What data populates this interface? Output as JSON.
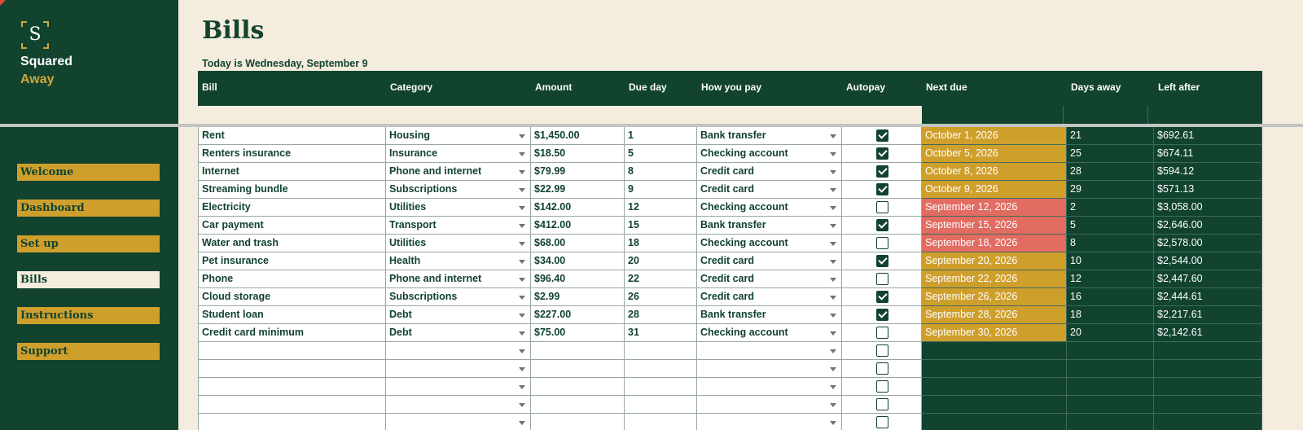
{
  "brand": {
    "logo_letter": "S",
    "name_line1": "Squared",
    "name_line2": "Away"
  },
  "nav": [
    {
      "label": "Welcome",
      "active": false
    },
    {
      "label": "Dashboard",
      "active": false
    },
    {
      "label": "Set up",
      "active": false
    },
    {
      "label": "Bills",
      "active": true
    },
    {
      "label": "Instructions",
      "active": false
    },
    {
      "label": "Support",
      "active": false
    }
  ],
  "page": {
    "title": "Bills",
    "today": "Today is Wednesday, September 9"
  },
  "columns": [
    "Bill",
    "Category",
    "Amount",
    "Due day",
    "How you pay",
    "Autopay",
    "Next due",
    "Days away",
    "Left after"
  ],
  "rows": [
    {
      "bill": "Rent",
      "category": "Housing",
      "amount": "$1,450.00",
      "due_day": "1",
      "pay": "Bank transfer",
      "autopay": true,
      "next_due": "October 1, 2026",
      "status": "gold",
      "days_away": "21",
      "left_after": "$692.61"
    },
    {
      "bill": "Renters insurance",
      "category": "Insurance",
      "amount": "$18.50",
      "due_day": "5",
      "pay": "Checking account",
      "autopay": true,
      "next_due": "October 5, 2026",
      "status": "gold",
      "days_away": "25",
      "left_after": "$674.11"
    },
    {
      "bill": "Internet",
      "category": "Phone and internet",
      "amount": "$79.99",
      "due_day": "8",
      "pay": "Credit card",
      "autopay": true,
      "next_due": "October 8, 2026",
      "status": "gold",
      "days_away": "28",
      "left_after": "$594.12"
    },
    {
      "bill": "Streaming bundle",
      "category": "Subscriptions",
      "amount": "$22.99",
      "due_day": "9",
      "pay": "Credit card",
      "autopay": true,
      "next_due": "October 9, 2026",
      "status": "gold",
      "days_away": "29",
      "left_after": "$571.13"
    },
    {
      "bill": "Electricity",
      "category": "Utilities",
      "amount": "$142.00",
      "due_day": "12",
      "pay": "Checking account",
      "autopay": false,
      "next_due": "September 12, 2026",
      "status": "red",
      "days_away": "2",
      "left_after": "$3,058.00"
    },
    {
      "bill": "Car payment",
      "category": "Transport",
      "amount": "$412.00",
      "due_day": "15",
      "pay": "Bank transfer",
      "autopay": true,
      "next_due": "September 15, 2026",
      "status": "red",
      "days_away": "5",
      "left_after": "$2,646.00"
    },
    {
      "bill": "Water and trash",
      "category": "Utilities",
      "amount": "$68.00",
      "due_day": "18",
      "pay": "Checking account",
      "autopay": false,
      "next_due": "September 18, 2026",
      "status": "red",
      "days_away": "8",
      "left_after": "$2,578.00"
    },
    {
      "bill": "Pet insurance",
      "category": "Health",
      "amount": "$34.00",
      "due_day": "20",
      "pay": "Credit card",
      "autopay": true,
      "next_due": "September 20, 2026",
      "status": "gold",
      "days_away": "10",
      "left_after": "$2,544.00"
    },
    {
      "bill": "Phone",
      "category": "Phone and internet",
      "amount": "$96.40",
      "due_day": "22",
      "pay": "Credit card",
      "autopay": false,
      "next_due": "September 22, 2026",
      "status": "gold",
      "days_away": "12",
      "left_after": "$2,447.60"
    },
    {
      "bill": "Cloud storage",
      "category": "Subscriptions",
      "amount": "$2.99",
      "due_day": "26",
      "pay": "Credit card",
      "autopay": true,
      "next_due": "September 26, 2026",
      "status": "gold",
      "days_away": "16",
      "left_after": "$2,444.61"
    },
    {
      "bill": "Student loan",
      "category": "Debt",
      "amount": "$227.00",
      "due_day": "28",
      "pay": "Bank transfer",
      "autopay": true,
      "next_due": "September 28, 2026",
      "status": "gold",
      "days_away": "18",
      "left_after": "$2,217.61"
    },
    {
      "bill": "Credit card minimum",
      "category": "Debt",
      "amount": "$75.00",
      "due_day": "31",
      "pay": "Checking account",
      "autopay": false,
      "next_due": "September 30, 2026",
      "status": "gold",
      "days_away": "20",
      "left_after": "$2,142.61"
    },
    {
      "bill": "",
      "category": "",
      "amount": "",
      "due_day": "",
      "pay": "",
      "autopay": false,
      "next_due": "",
      "status": "none",
      "days_away": "",
      "left_after": ""
    },
    {
      "bill": "",
      "category": "",
      "amount": "",
      "due_day": "",
      "pay": "",
      "autopay": false,
      "next_due": "",
      "status": "none",
      "days_away": "",
      "left_after": ""
    },
    {
      "bill": "",
      "category": "",
      "amount": "",
      "due_day": "",
      "pay": "",
      "autopay": false,
      "next_due": "",
      "status": "none",
      "days_away": "",
      "left_after": ""
    },
    {
      "bill": "",
      "category": "",
      "amount": "",
      "due_day": "",
      "pay": "",
      "autopay": false,
      "next_due": "",
      "status": "none",
      "days_away": "",
      "left_after": ""
    },
    {
      "bill": "",
      "category": "",
      "amount": "",
      "due_day": "",
      "pay": "",
      "autopay": false,
      "next_due": "",
      "status": "none",
      "days_away": "",
      "left_after": ""
    }
  ],
  "colors": {
    "brand_green": "#11432f",
    "gold": "#cf9f2c",
    "alert_red": "#e26b62",
    "cream": "#f4ecdc"
  }
}
